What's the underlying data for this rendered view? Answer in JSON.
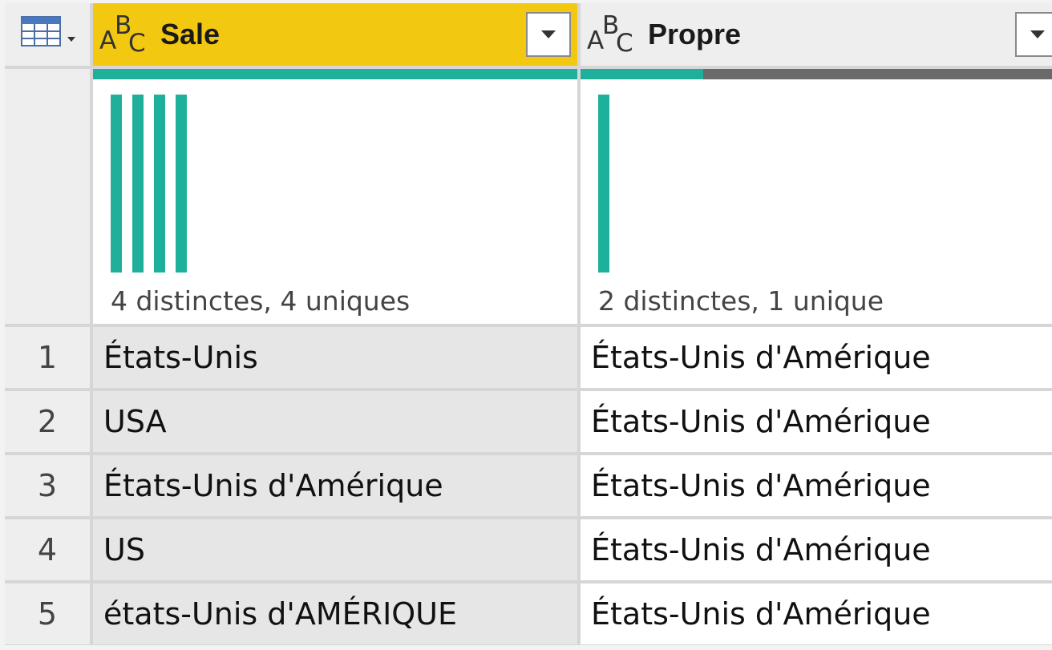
{
  "columns": [
    {
      "name": "Sale",
      "type_icon": "abc-text-type-icon",
      "selected": true,
      "distinct_label": "4 distinctes, 4 uniques",
      "valid_fraction": 1.0,
      "bar_count": 4
    },
    {
      "name": "Propre",
      "type_icon": "abc-text-type-icon",
      "selected": false,
      "distinct_label": "2 distinctes, 1 unique",
      "valid_fraction": 0.26,
      "bar_count": 1
    }
  ],
  "type_icon_letters": {
    "a": "A",
    "b": "B",
    "c": "C"
  },
  "rows": [
    {
      "num": "1",
      "sale": "États-Unis",
      "propre": "États-Unis d'Amérique"
    },
    {
      "num": "2",
      "sale": "USA",
      "propre": "États-Unis d'Amérique"
    },
    {
      "num": "3",
      "sale": "États-Unis d'Amérique",
      "propre": "États-Unis d'Amérique"
    },
    {
      "num": "4",
      "sale": "US",
      "propre": "États-Unis d'Amérique"
    },
    {
      "num": "5",
      "sale": "états-Unis d'AMÉRIQUE",
      "propre": "États-Unis d'Amérique"
    }
  ],
  "colors": {
    "selected_header": "#f2c811",
    "valid": "#1fb09c",
    "empty": "#6a6a6a"
  }
}
